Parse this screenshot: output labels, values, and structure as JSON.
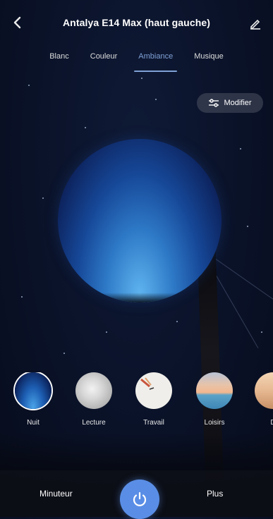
{
  "header": {
    "title": "Antalya E14 Max (haut gauche)",
    "back_icon": "back-chevron-icon",
    "edit_icon": "edit-pencil-icon"
  },
  "tabs": [
    {
      "label": "Blanc",
      "active": false
    },
    {
      "label": "Couleur",
      "active": false
    },
    {
      "label": "Ambiance",
      "active": true
    },
    {
      "label": "Musique",
      "active": false
    }
  ],
  "modify_button": {
    "label": "Modifier",
    "icon": "sliders-icon"
  },
  "scenes": [
    {
      "label": "Nuit",
      "selected": true
    },
    {
      "label": "Lecture",
      "selected": false
    },
    {
      "label": "Travail",
      "selected": false
    },
    {
      "label": "Loisirs",
      "selected": false
    },
    {
      "label": "D",
      "selected": false
    }
  ],
  "bottom_bar": {
    "timer_label": "Minuteur",
    "more_label": "Plus",
    "power_icon": "power-icon"
  },
  "colors": {
    "accent": "#5a8ee6",
    "tab_active": "#7fa1d6",
    "background": "#0a1228"
  }
}
